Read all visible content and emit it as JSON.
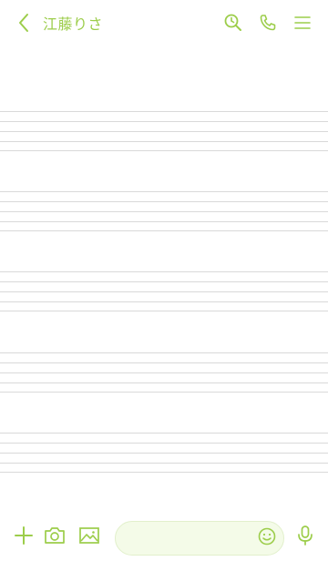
{
  "header": {
    "title": "江藤りさ",
    "back_icon": "chevron-left-icon",
    "icons": [
      "search-icon",
      "phone-icon",
      "menu-icon"
    ]
  },
  "colors": {
    "accent": "#9ccd4a",
    "staff_line": "#d9d9d9",
    "input_bg": "#f4fbe8"
  },
  "bottom_bar": {
    "icons": [
      "plus-icon",
      "camera-icon",
      "image-icon",
      "smiley-icon",
      "microphone-icon"
    ],
    "message_input": {
      "placeholder": "",
      "value": ""
    }
  }
}
